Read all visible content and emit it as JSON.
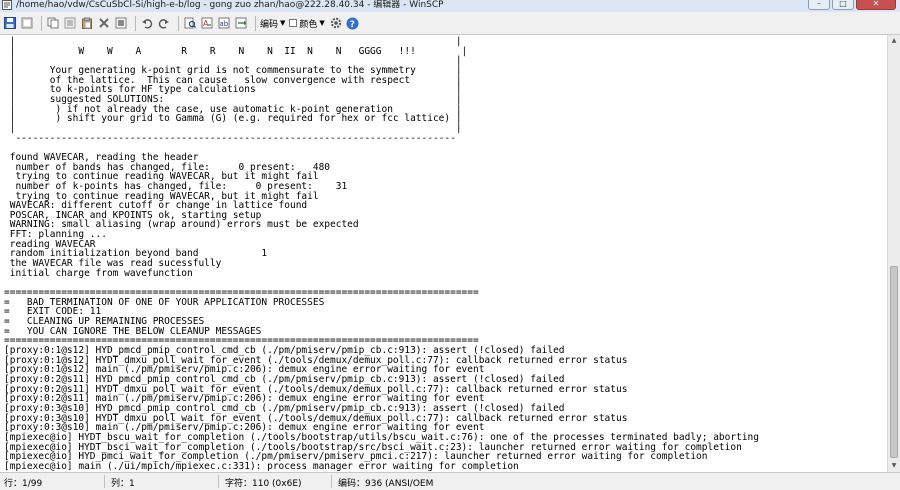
{
  "window": {
    "title": "/home/hao/vdw/CsCuSbCl-Si/high-e-b/log - gong zuo zhan/hao@222.28.40.34 - 编辑器 - WinSCP"
  },
  "toolbar": {
    "encoding_label": "编码",
    "color_label": "颜色"
  },
  "editor": {
    "lines": [
      " |                                                                             |",
      " |           W    W    A       R    R    N    N  II  N    N   GGGG   !!!        |",
      " |                                                                             |",
      " |      Your generating k-point grid is not commensurate to the symmetry       |",
      " |      of the lattice.  This can cause   slow convergence with respect        |",
      " |      to k-points for HF type calculations                                   |",
      " |      suggested SOLUTIONS:                                                   |",
      " |       ) if not already the case, use automatic k-point generation           |",
      " |       ) shift your grid to Gamma (G) (e.g. required for hex or fcc lattice) |",
      " |                                                                             |",
      "  ----------------------------------------------------------------------------- ",
      "",
      " found WAVECAR, reading the header",
      "  number of bands has changed, file:     0 present:   480",
      "  trying to continue reading WAVECAR, but it might fail",
      "  number of k-points has changed, file:     0 present:    31",
      "  trying to continue reading WAVECAR, but it might fail",
      " WAVECAR: different cutoff or change in lattice found",
      " POSCAR, INCAR and KPOINTS ok, starting setup",
      " WARNING: small aliasing (wrap around) errors must be expected",
      " FFT: planning ...",
      " reading WAVECAR",
      " random initialization beyond band           1",
      " the WAVECAR file was read sucessfully",
      " initial charge from wavefunction",
      "",
      "===================================================================================",
      "=   BAD TERMINATION OF ONE OF YOUR APPLICATION PROCESSES",
      "=   EXIT CODE: 11",
      "=   CLEANING UP REMAINING PROCESSES",
      "=   YOU CAN IGNORE THE BELOW CLEANUP MESSAGES",
      "===================================================================================",
      "[proxy:0:1@s12] HYD_pmcd_pmip_control_cmd_cb (./pm/pmiserv/pmip_cb.c:913): assert (!closed) failed",
      "[proxy:0:1@s12] HYDT_dmxu_poll_wait_for_event (./tools/demux/demux_poll.c:77): callback returned error status",
      "[proxy:0:1@s12] main (./pm/pmiserv/pmip.c:206): demux engine error waiting for event",
      "[proxy:0:2@s11] HYD_pmcd_pmip_control_cmd_cb (./pm/pmiserv/pmip_cb.c:913): assert (!closed) failed",
      "[proxy:0:2@s11] HYDT_dmxu_poll_wait_for_event (./tools/demux/demux_poll.c:77): callback returned error status",
      "[proxy:0:2@s11] main (./pm/pmiserv/pmip.c:206): demux engine error waiting for event",
      "[proxy:0:3@s10] HYD_pmcd_pmip_control_cmd_cb (./pm/pmiserv/pmip_cb.c:913): assert (!closed) failed",
      "[proxy:0:3@s10] HYDT_dmxu_poll_wait_for_event (./tools/demux/demux_poll.c:77): callback returned error status",
      "[proxy:0:3@s10] main (./pm/pmiserv/pmip.c:206): demux engine error waiting for event",
      "[mpiexec@io] HYDT_bscu_wait_for_completion (./tools/bootstrap/utils/bscu_wait.c:76): one of the processes terminated badly; aborting",
      "[mpiexec@io] HYDT_bsci_wait_for_completion (./tools/bootstrap/src/bsci_wait.c:23): launcher returned error waiting for completion",
      "[mpiexec@io] HYD_pmci_wait_for_completion (./pm/pmiserv/pmiserv_pmci.c:217): launcher returned error waiting for completion",
      "[mpiexec@io] main (./ui/mpich/mpiexec.c:331): process manager error waiting for completion"
    ]
  },
  "scrollbar": {
    "thumb_start_fraction": 0.53,
    "thumb_end_fraction": 0.995
  },
  "status": {
    "line": "行：1/99",
    "column": "列：1",
    "char": "字符：110 (0x6E)",
    "encoding": "编码：936  (ANSI/OEM"
  },
  "icons": [
    "winscp-app-icon",
    "save-icon",
    "reload-icon",
    "copy-icon",
    "cut-icon",
    "paste-icon",
    "delete-icon",
    "undo-icon",
    "redo-icon",
    "find-icon",
    "find-next-icon",
    "replace-icon",
    "goto-line-icon",
    "preferences-icon",
    "gear-icon",
    "help-icon"
  ]
}
